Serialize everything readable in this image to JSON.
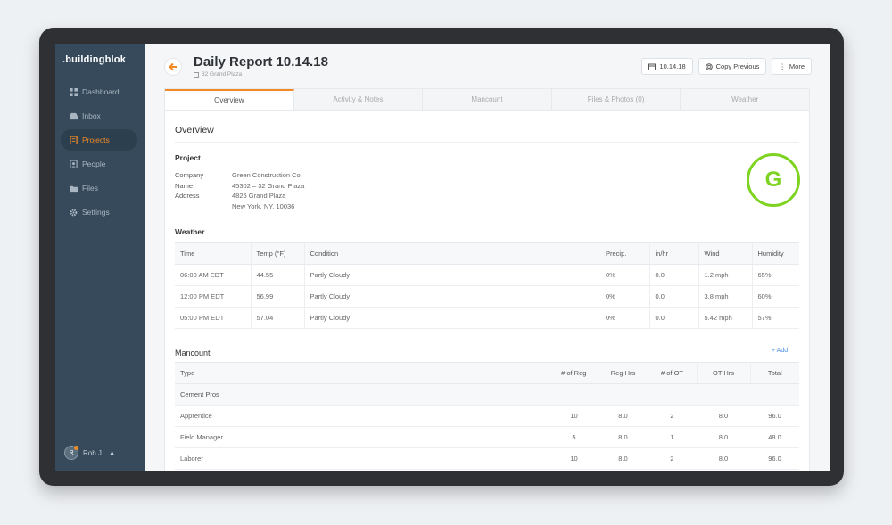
{
  "app": {
    "logo": ".buildingblok"
  },
  "sidebar": {
    "items": [
      {
        "label": "Dashboard",
        "icon": "dashboard-icon"
      },
      {
        "label": "Inbox",
        "icon": "inbox-icon"
      },
      {
        "label": "Projects",
        "icon": "projects-icon",
        "active": true
      },
      {
        "label": "People",
        "icon": "people-icon"
      },
      {
        "label": "Files",
        "icon": "folder-icon"
      },
      {
        "label": "Settings",
        "icon": "gear-icon"
      }
    ],
    "user": {
      "initial": "R",
      "name": "Rob J."
    }
  },
  "header": {
    "title": "Daily Report 10.14.18",
    "subtitle": "32 Grand Plaza",
    "date_button": "10.14.18",
    "copy_button": "Copy Previous",
    "more_button": "More"
  },
  "tabs": [
    {
      "label": "Overview",
      "active": true
    },
    {
      "label": "Activity & Notes"
    },
    {
      "label": "Mancount"
    },
    {
      "label": "Files & Photos (0)"
    },
    {
      "label": "Weather"
    }
  ],
  "overview": {
    "title": "Overview",
    "grade": "G",
    "project": {
      "title": "Project",
      "rows": [
        {
          "key": "Company",
          "value": "Green Construction Co"
        },
        {
          "key": "Name",
          "value": "45302 – 32 Grand Plaza"
        },
        {
          "key": "Address",
          "value": "4825 Grand Plaza"
        },
        {
          "key": "",
          "value": "New York, NY, 10036"
        }
      ]
    },
    "weather": {
      "title": "Weather",
      "headers": [
        "Time",
        "Temp (°F)",
        "Condition",
        "Precip.",
        "in/hr",
        "Wind",
        "Humidity"
      ],
      "rows": [
        [
          "06:00 AM EDT",
          "44.55",
          "Partly Cloudy",
          "0%",
          "0.0",
          "1.2 mph",
          "65%"
        ],
        [
          "12:00 PM EDT",
          "56.99",
          "Partly Cloudy",
          "0%",
          "0.0",
          "3.8 mph",
          "60%"
        ],
        [
          "05:00 PM EDT",
          "57.04",
          "Partly Cloudy",
          "0%",
          "0.0",
          "5.42 mph",
          "57%"
        ]
      ]
    },
    "mancount": {
      "title": "Mancount",
      "add_label": "+ Add",
      "headers": [
        "Type",
        "# of Reg",
        "Reg Hrs",
        "# of OT",
        "OT Hrs",
        "Total"
      ],
      "group": "Cement Pros",
      "rows": [
        [
          "Apprentice",
          "10",
          "8.0",
          "2",
          "8.0",
          "96.0"
        ],
        [
          "Field Manager",
          "5",
          "8.0",
          "1",
          "8.0",
          "48.0"
        ],
        [
          "Laborer",
          "10",
          "8.0",
          "2",
          "8.0",
          "96.0"
        ]
      ]
    }
  },
  "colors": {
    "accent": "#f08a24",
    "sidebar": "#364a5b",
    "grade": "#7ed321",
    "link": "#4a90e2"
  }
}
